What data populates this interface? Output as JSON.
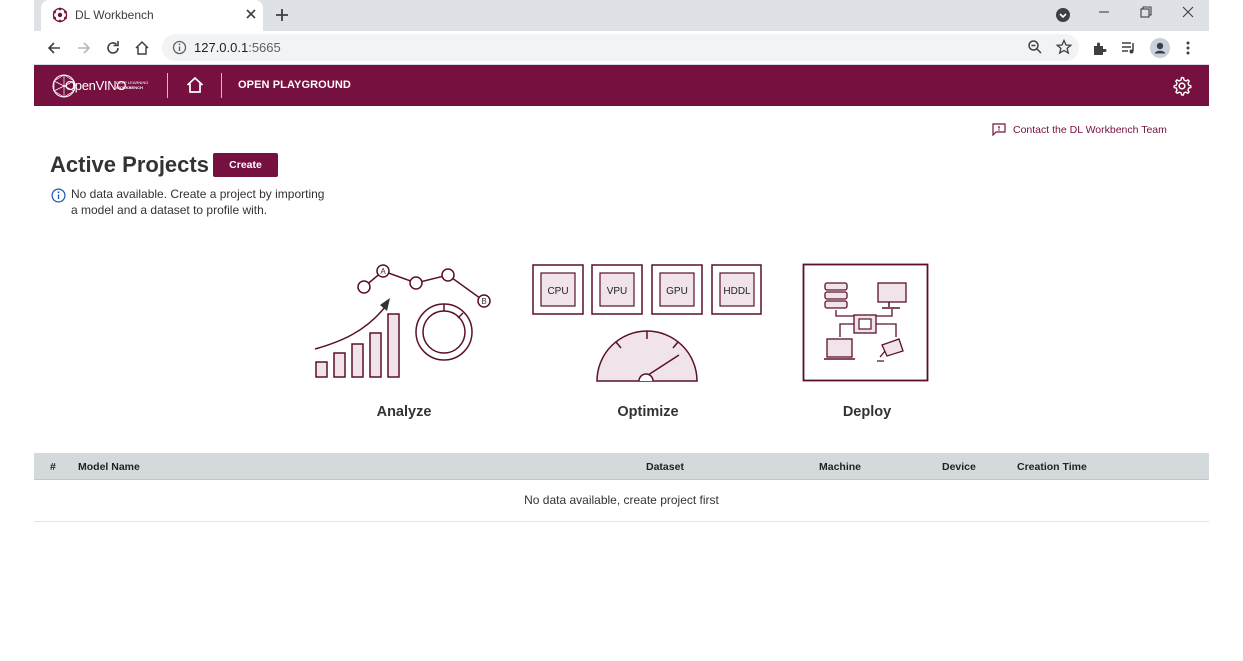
{
  "browser": {
    "tab_title": "DL Workbench",
    "url_host": "127.0.0.1",
    "url_port": ":5665",
    "icons": [
      "favicon-icon",
      "close-icon",
      "plus-icon",
      "tab-search-icon",
      "minimize-icon",
      "restore-icon",
      "close-window-icon",
      "back-icon",
      "forward-icon",
      "reload-icon",
      "home-icon",
      "info-icon",
      "zoom-icon",
      "star-icon",
      "extensions-icon",
      "media-icon",
      "profile-icon",
      "menu-icon"
    ]
  },
  "appbar": {
    "logo_main": "OpenVINO",
    "logo_sub_1": "DEEP LEARNING",
    "logo_sub_2": "WORKBENCH",
    "nav_link": "OPEN PLAYGROUND",
    "brand_color": "#76103f"
  },
  "contact": {
    "label": "Contact the DL Workbench Team"
  },
  "main": {
    "title": "Active Projects",
    "create_label": "Create",
    "info_message": "No data available. Create a project by importing a model and a dataset to profile with."
  },
  "features": [
    {
      "label": "Analyze",
      "points": [
        "A",
        "B"
      ]
    },
    {
      "label": "Optimize",
      "devices": [
        "CPU",
        "VPU",
        "GPU",
        "HDDL"
      ]
    },
    {
      "label": "Deploy"
    }
  ],
  "table": {
    "columns": [
      "#",
      "Model Name",
      "Dataset",
      "Machine",
      "Device",
      "Creation Time"
    ],
    "empty_message": "No data available, create project first"
  }
}
